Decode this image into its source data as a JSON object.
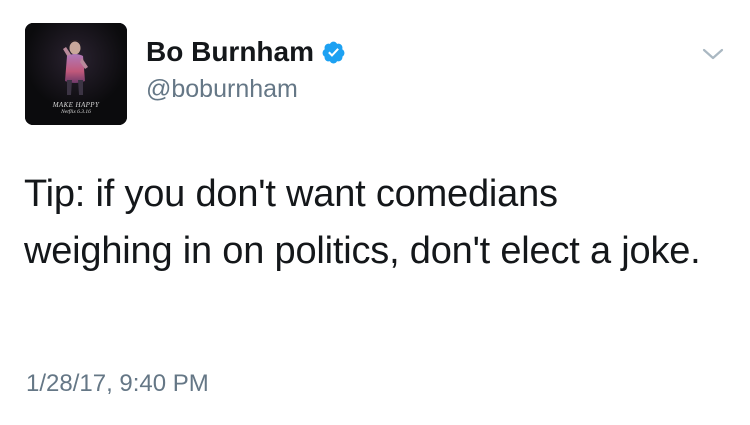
{
  "tweet": {
    "author": {
      "display_name": "Bo Burnham",
      "handle": "@boburnham",
      "verified": true,
      "avatar": {
        "caption_line1": "MAKE HAPPY",
        "caption_line2": "Netflix 6.3.16"
      }
    },
    "text": "Tip: if you don't want comedians weighing in on politics, don't elect a joke.",
    "timestamp": "1/28/17, 9:40 PM"
  },
  "colors": {
    "verified_badge": "#1da1f2",
    "secondary_text": "#657786",
    "primary_text": "#14171a",
    "caret": "#aab8c2"
  },
  "icons": {
    "verified": "verified-badge-icon",
    "menu": "chevron-down-icon"
  }
}
